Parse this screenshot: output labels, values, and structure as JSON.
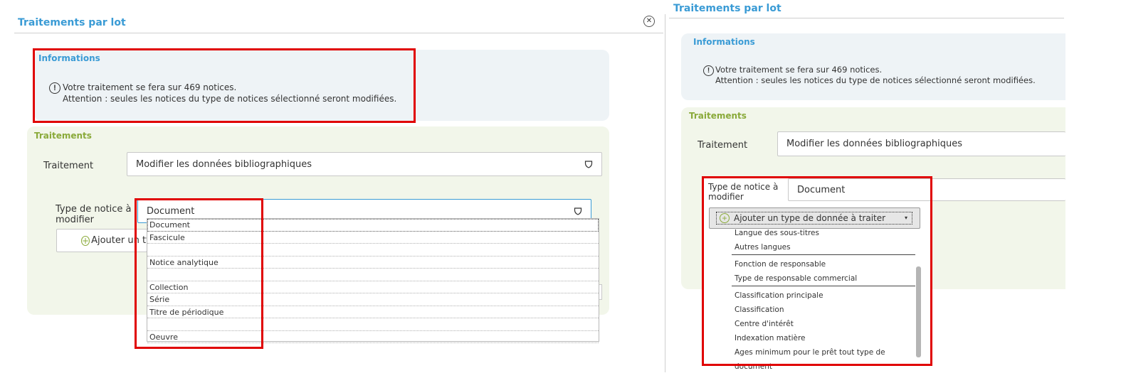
{
  "left_panel": {
    "title": "Traitements par lot",
    "close_icon": "close-circle-icon",
    "info": {
      "title": "Informations",
      "line1": "Votre traitement se fera sur 469 notices.",
      "line2": "Attention : seules les notices du type de notices sélectionné seront modifiées.",
      "icon": "exclamation-circle-icon"
    },
    "traitements": {
      "title": "Traitements",
      "traitement_label": "Traitement",
      "traitement_value": "Modifier les données bibliographiques",
      "type_label": "Type de notice à modifier",
      "type_value": "Document",
      "add_label": "Ajouter un ty",
      "dropdown_options": [
        "Document",
        "Fascicule",
        "",
        "Notice analytique",
        "",
        "Collection",
        "Série",
        "Titre de périodique",
        "",
        "Oeuvre"
      ]
    }
  },
  "right_panel": {
    "title": "Traitements par lot",
    "info": {
      "title": "Informations",
      "line1": "Votre traitement se fera sur 469 notices.",
      "line2": "Attention : seules les notices du type de notices sélectionné seront modifiées."
    },
    "traitements": {
      "title": "Traitements",
      "traitement_label": "Traitement",
      "traitement_value": "Modifier les données bibliographiques",
      "type_label": "Type de notice à modifier",
      "type_value": "Document",
      "add_label": "Ajouter un type de donnée à traiter",
      "dropdown_groups": [
        [
          "Langue des sous-titres",
          "Autres langues"
        ],
        [
          "Fonction de responsable",
          "Type de responsable commercial"
        ],
        [
          "Classification principale",
          "Classification",
          "Centre d'intérêt",
          "Indexation matière",
          "Ages minimum pour le prêt tout type de document"
        ]
      ]
    }
  },
  "colors": {
    "accent_blue": "#3a9bd5",
    "accent_green": "#8aaa3a",
    "highlight_red": "#e00000"
  }
}
